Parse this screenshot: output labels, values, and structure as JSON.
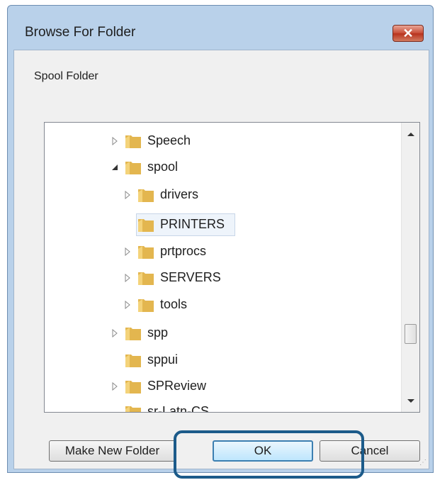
{
  "window": {
    "title": "Browse For Folder",
    "close_label": "✕",
    "prompt": "Spool Folder"
  },
  "tree": {
    "items": [
      {
        "label": "Speech",
        "expander": "collapsed"
      },
      {
        "label": "spool",
        "expander": "expanded"
      },
      {
        "label": "drivers",
        "expander": "collapsed"
      },
      {
        "label": "PRINTERS",
        "expander": "none",
        "selected": true
      },
      {
        "label": "prtprocs",
        "expander": "collapsed"
      },
      {
        "label": "SERVERS",
        "expander": "collapsed"
      },
      {
        "label": "tools",
        "expander": "collapsed"
      },
      {
        "label": "spp",
        "expander": "collapsed"
      },
      {
        "label": "sppui",
        "expander": "none"
      },
      {
        "label": "SPReview",
        "expander": "collapsed"
      },
      {
        "label": "sr-Latn-CS",
        "expander": "none"
      }
    ]
  },
  "buttons": {
    "make_new_folder": "Make New Folder",
    "ok": "OK",
    "cancel": "Cancel"
  },
  "colors": {
    "folder": "#e3b64f",
    "highlight_outline": "#1c5b8a"
  }
}
